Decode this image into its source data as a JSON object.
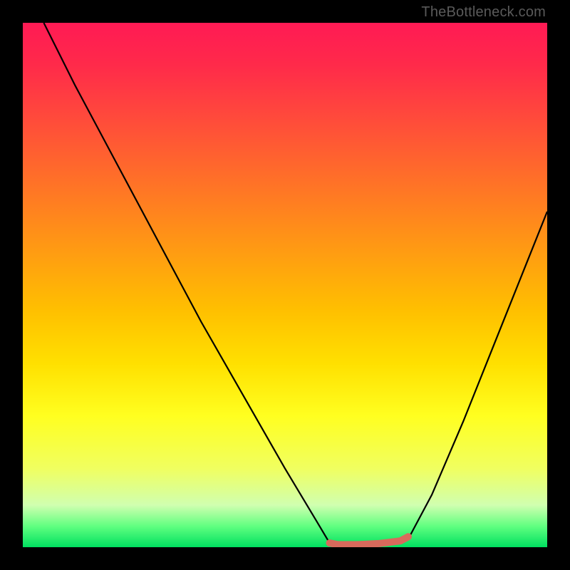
{
  "watermark": "TheBottleneck.com",
  "chart_data": {
    "type": "line",
    "title": "",
    "xlabel": "",
    "ylabel": "",
    "xlim": [
      0,
      100
    ],
    "ylim": [
      0,
      100
    ],
    "grid": false,
    "background": "rainbow-vertical-gradient",
    "series": [
      {
        "name": "bottleneck-curve",
        "color": "#000000",
        "x": [
          4,
          10,
          18,
          26,
          34,
          42,
          50,
          56,
          58.5,
          60,
          64,
          68,
          72,
          74,
          78,
          84,
          90,
          96,
          100
        ],
        "values": [
          100,
          88,
          73,
          58,
          43,
          29,
          15,
          5,
          0.8,
          0.5,
          0.5,
          0.7,
          1.2,
          2.5,
          10,
          24,
          39,
          54,
          64
        ]
      },
      {
        "name": "optimal-marker",
        "color": "#d86a5c",
        "type": "marker-line",
        "x": [
          58.5,
          60,
          64,
          68,
          72,
          73.5
        ],
        "values": [
          0.8,
          0.5,
          0.5,
          0.7,
          1.2,
          2.0
        ]
      }
    ],
    "markers": [
      {
        "name": "optimal-start-dot",
        "x": 58.5,
        "y": 0.8,
        "color": "#d86a5c",
        "r": 5
      }
    ]
  }
}
